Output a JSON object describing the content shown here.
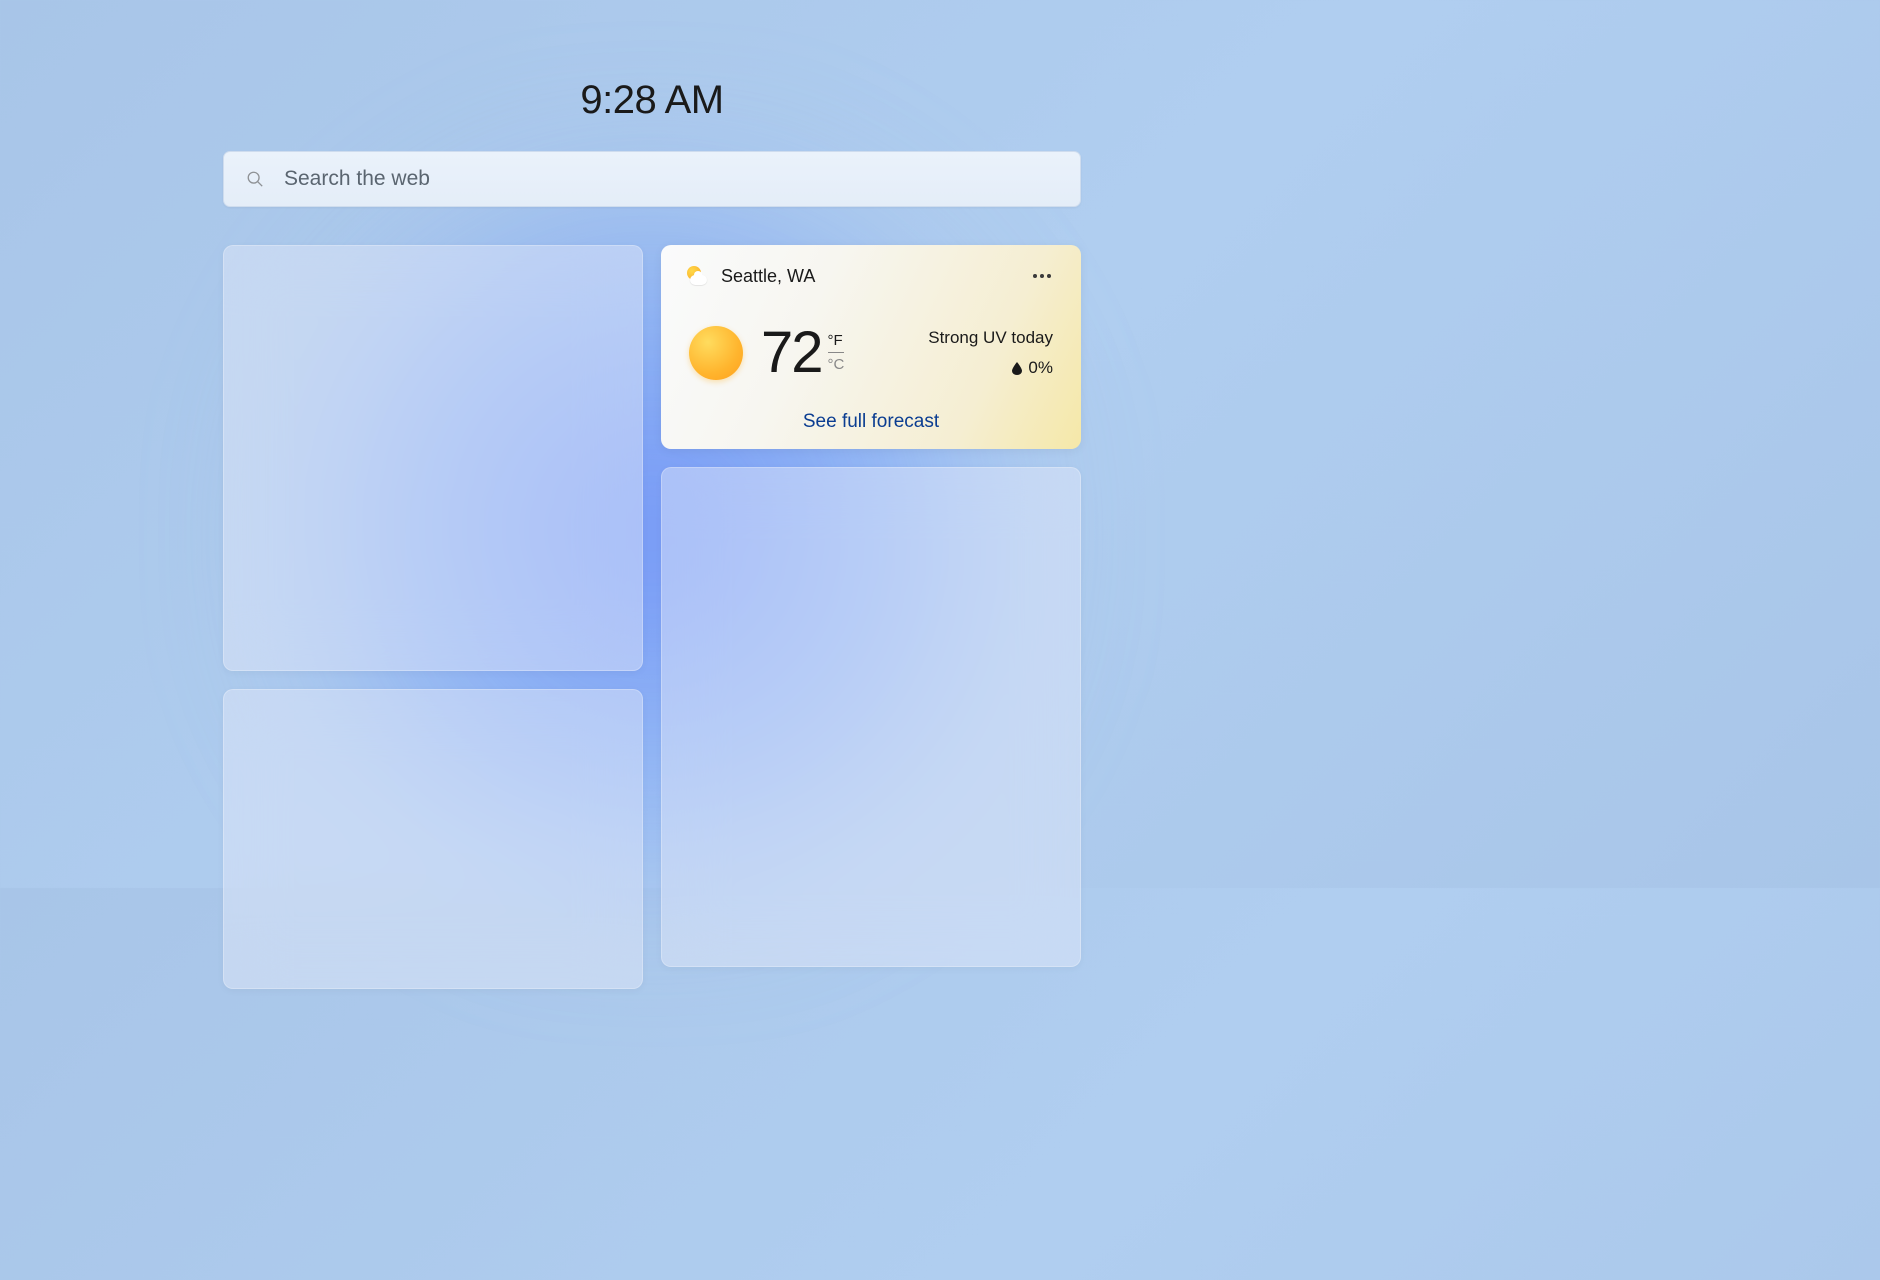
{
  "clock": {
    "time": "9:28 AM"
  },
  "search": {
    "placeholder": "Search the web"
  },
  "weather": {
    "location": "Seattle, WA",
    "temperature": "72",
    "unit_primary": "°F",
    "unit_secondary": "°C",
    "condition_text": "Strong UV today",
    "precipitation": "0%",
    "forecast_link": "See full forecast"
  }
}
